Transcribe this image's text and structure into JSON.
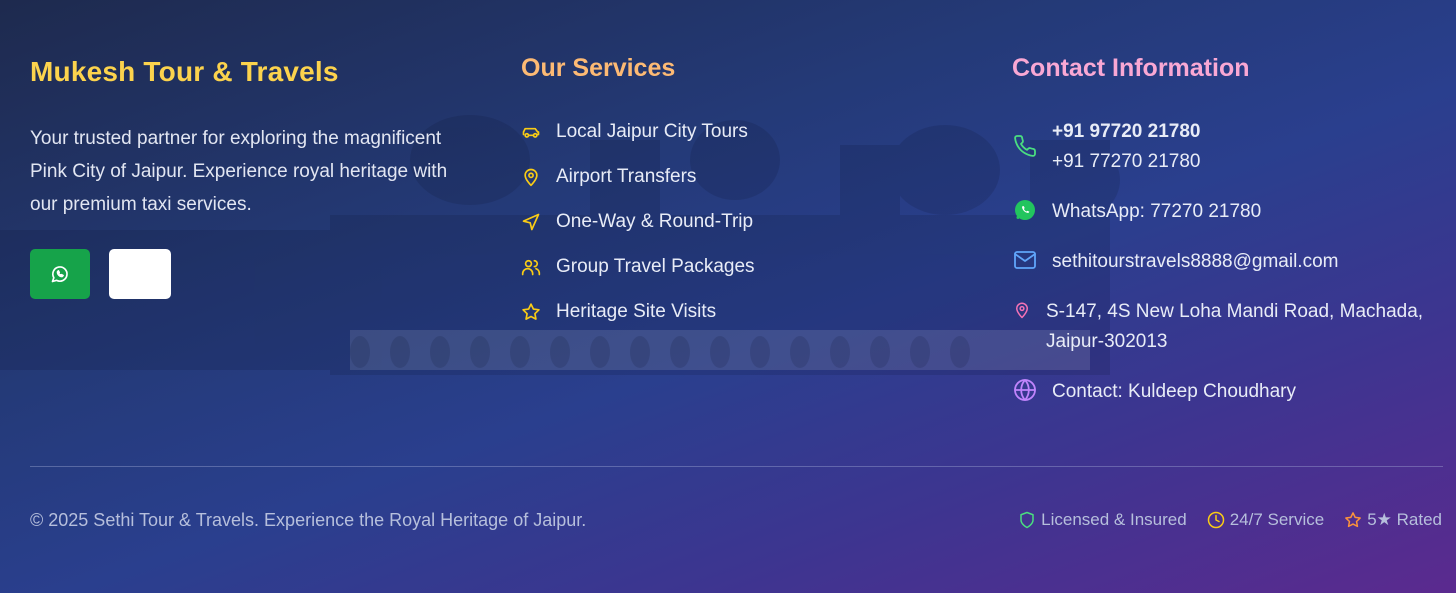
{
  "brand": {
    "title": "Mukesh Tour & Travels",
    "about": "Your trusted partner for exploring the magnificent Pink City of Jaipur. Experience royal heritage with our premium taxi services.",
    "social": [
      "whatsapp-icon",
      "blank"
    ]
  },
  "services": {
    "title": "Our Services",
    "items": [
      {
        "label": "Local Jaipur City Tours",
        "icon": "car-icon"
      },
      {
        "label": "Airport Transfers",
        "icon": "map-pin-icon"
      },
      {
        "label": "One-Way & Round-Trip",
        "icon": "navigation-icon"
      },
      {
        "label": "Group Travel Packages",
        "icon": "users-icon"
      },
      {
        "label": "Heritage Site Visits",
        "icon": "star-icon"
      }
    ]
  },
  "contact": {
    "title": "Contact Information",
    "phone1": "+91 97720 21780",
    "phone2": "+91 77270 21780",
    "whatsapp": "WhatsApp: 77270 21780",
    "email": "sethitourstravels8888@gmail.com",
    "address": "S-147, 4S New Loha Mandi Road, Machada, Jaipur-302013",
    "person": "Contact: Kuldeep Choudhary"
  },
  "bottom": {
    "copyright": "© 2025 Sethi Tour & Travels. Experience the Royal Heritage of Jaipur.",
    "badges": [
      {
        "label": "Licensed & Insured",
        "icon": "shield-icon"
      },
      {
        "label": "24/7 Service",
        "icon": "clock-icon"
      },
      {
        "label": "5★ Rated",
        "icon": "star-icon"
      }
    ]
  },
  "colors": {
    "brand": "#fcd34d",
    "services_title": "#fdba74",
    "contact_title": "#f9a8d4",
    "whatsapp": "#16a34a",
    "accent_yellow": "#facc15",
    "phone_green": "#4ade80",
    "email_blue": "#60a5fa",
    "pin_pink": "#f472b6",
    "globe_purple": "#c084fc"
  }
}
